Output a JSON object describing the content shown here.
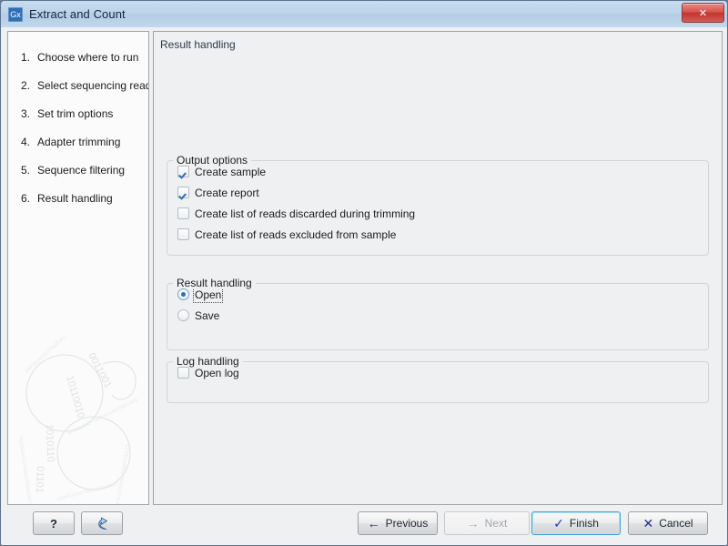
{
  "window": {
    "title": "Extract and Count",
    "app_icon_label": "Gx",
    "close_label": "✕"
  },
  "sidebar": {
    "steps": [
      {
        "num": "1.",
        "label": "Choose where to run"
      },
      {
        "num": "2.",
        "label": "Select sequencing reads"
      },
      {
        "num": "3.",
        "label": "Set trim options"
      },
      {
        "num": "4.",
        "label": "Adapter trimming"
      },
      {
        "num": "5.",
        "label": "Sequence filtering"
      },
      {
        "num": "6.",
        "label": "Result handling"
      }
    ]
  },
  "content": {
    "header": "Result handling",
    "output_options": {
      "title": "Output options",
      "items": [
        {
          "label": "Create sample",
          "checked": true
        },
        {
          "label": "Create report",
          "checked": true
        },
        {
          "label": "Create list of reads discarded during trimming",
          "checked": false
        },
        {
          "label": "Create list of reads excluded from sample",
          "checked": false
        }
      ]
    },
    "result_handling": {
      "title": "Result handling",
      "options": [
        {
          "label": "Open",
          "selected": true,
          "focused": true
        },
        {
          "label": "Save",
          "selected": false,
          "focused": false
        }
      ]
    },
    "log_handling": {
      "title": "Log handling",
      "items": [
        {
          "label": "Open log",
          "checked": false
        }
      ]
    }
  },
  "buttons": {
    "help": "?",
    "reset": "",
    "previous": "Previous",
    "next": "Next",
    "finish": "Finish",
    "cancel": "Cancel"
  },
  "colors": {
    "accent": "#2f6fb5",
    "titlebar": "#b8cde4",
    "close_button": "#d9534f",
    "panel_bg": "#eff0f1",
    "focus_border": "#3c9fd4"
  }
}
